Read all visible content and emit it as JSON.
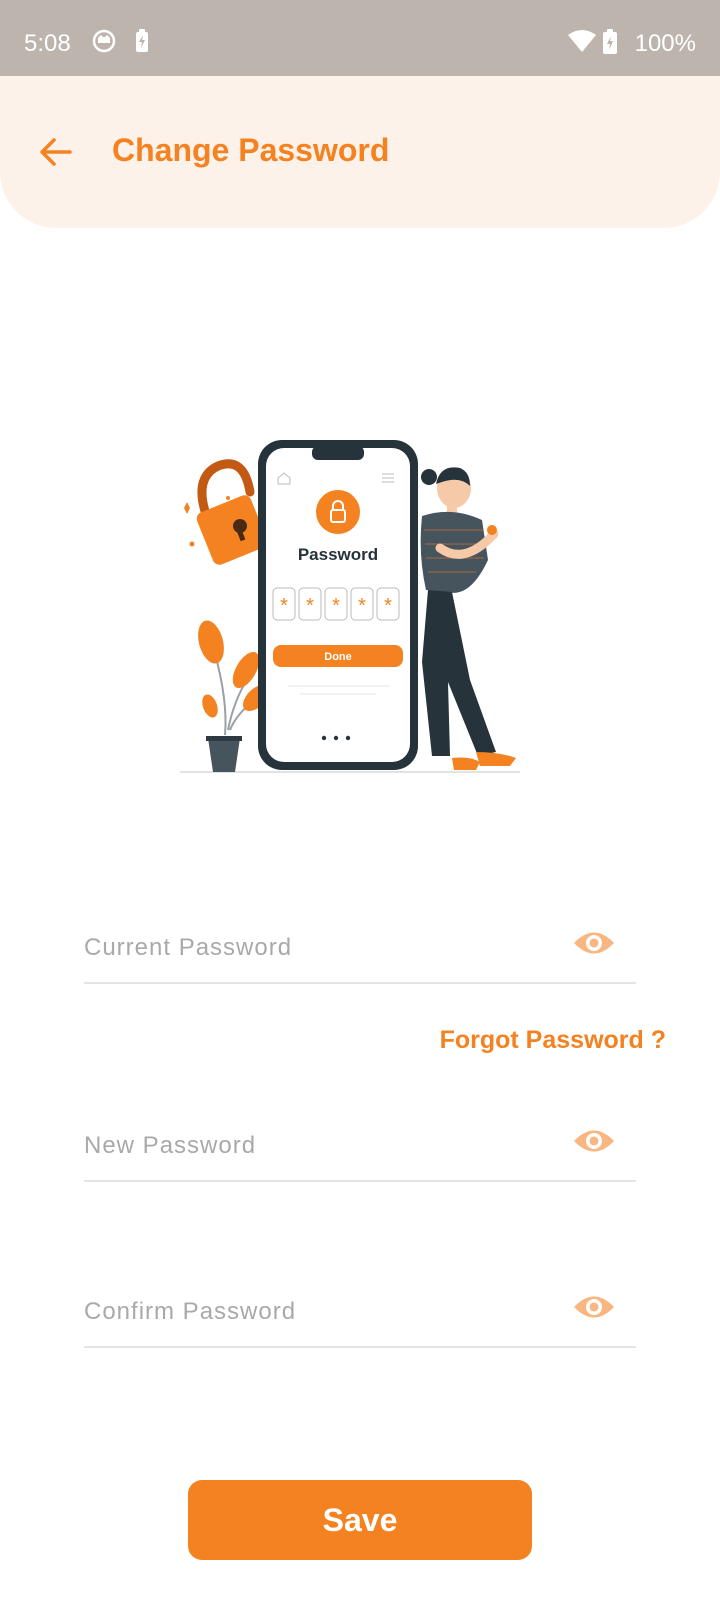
{
  "status_bar": {
    "time": "5:08",
    "battery_percent": "100%",
    "icons": [
      "cat-notification-icon",
      "battery-saver-icon",
      "wifi-icon",
      "battery-charging-icon"
    ]
  },
  "header": {
    "title": "Change Password",
    "back_icon": "arrow-left-icon"
  },
  "illustration": {
    "phone_title": "Password",
    "phone_masked_chars": [
      "*",
      "*",
      "*",
      "*",
      "*"
    ],
    "phone_button": "Done",
    "icons": [
      "padlock-icon",
      "plant-icon",
      "woman-figure-icon"
    ]
  },
  "form": {
    "current_password": {
      "placeholder": "Current Password",
      "value": ""
    },
    "forgot_password": "Forgot Password ?",
    "new_password": {
      "placeholder": "New Password",
      "value": ""
    },
    "confirm_password": {
      "placeholder": "Confirm Password",
      "value": ""
    },
    "eye_icon": "eye-icon",
    "save_label": "Save"
  },
  "colors": {
    "accent": "#f48221",
    "header_bg": "#fdf2e9",
    "status_bar_bg": "#beb4ae",
    "eye_icon": "#f7b682"
  }
}
